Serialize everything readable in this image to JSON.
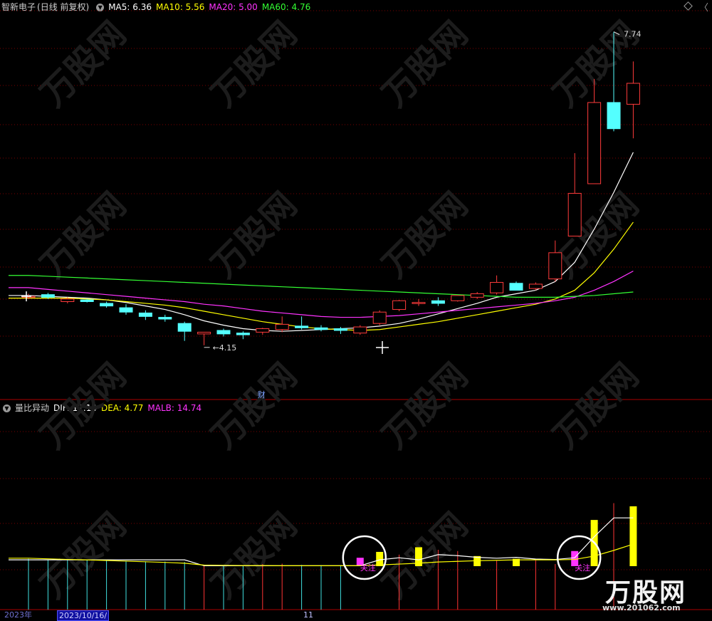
{
  "header_main": {
    "stock_name": "智新电子",
    "mode": "(日线 前复权)",
    "ma": [
      {
        "label": "MA5: 6.36",
        "color": "#ffffff"
      },
      {
        "label": "MA10: 5.56",
        "color": "#ffff00"
      },
      {
        "label": "MA20: 5.00",
        "color": "#ff33ff"
      },
      {
        "label": "MA60: 4.76",
        "color": "#33ff33"
      }
    ]
  },
  "header_sub": {
    "name": "量比异动",
    "items": [
      {
        "label": "DIF: 12.14",
        "color": "#ffffff"
      },
      {
        "label": "DEA: 4.77",
        "color": "#ffff00"
      },
      {
        "label": "MALB: 14.74",
        "color": "#ff33ff"
      }
    ]
  },
  "annotations": {
    "high_label": "7.74",
    "low_label": "4.15",
    "finance_marker": "财",
    "signal_text": "关注"
  },
  "bottom_axis": {
    "labels": [
      "2023年",
      "2023/10/16/",
      "11"
    ]
  },
  "watermark": {
    "brand": "万股网",
    "url": "www.201062.com"
  },
  "chart_data": {
    "type": "candlestick",
    "price_range": [
      3.7,
      7.9
    ],
    "high_mark": 7.74,
    "low_mark": 4.15,
    "candles": [
      {
        "o": 4.71,
        "h": 4.74,
        "l": 4.68,
        "c": 4.71
      },
      {
        "o": 4.73,
        "h": 4.75,
        "l": 4.68,
        "c": 4.7
      },
      {
        "o": 4.65,
        "h": 4.7,
        "l": 4.63,
        "c": 4.68
      },
      {
        "o": 4.67,
        "h": 4.68,
        "l": 4.64,
        "c": 4.65
      },
      {
        "o": 4.63,
        "h": 4.65,
        "l": 4.58,
        "c": 4.6
      },
      {
        "o": 4.58,
        "h": 4.62,
        "l": 4.5,
        "c": 4.53
      },
      {
        "o": 4.52,
        "h": 4.55,
        "l": 4.44,
        "c": 4.48
      },
      {
        "o": 4.47,
        "h": 4.5,
        "l": 4.42,
        "c": 4.45
      },
      {
        "o": 4.4,
        "h": 4.42,
        "l": 4.2,
        "c": 4.31
      },
      {
        "o": 4.28,
        "h": 4.3,
        "l": 4.15,
        "c": 4.3
      },
      {
        "o": 4.32,
        "h": 4.34,
        "l": 4.25,
        "c": 4.28
      },
      {
        "o": 4.29,
        "h": 4.31,
        "l": 4.22,
        "c": 4.27
      },
      {
        "o": 4.3,
        "h": 4.35,
        "l": 4.27,
        "c": 4.34
      },
      {
        "o": 4.33,
        "h": 4.48,
        "l": 4.3,
        "c": 4.39
      },
      {
        "o": 4.37,
        "h": 4.48,
        "l": 4.33,
        "c": 4.35
      },
      {
        "o": 4.35,
        "h": 4.38,
        "l": 4.31,
        "c": 4.33
      },
      {
        "o": 4.34,
        "h": 4.36,
        "l": 4.28,
        "c": 4.32
      },
      {
        "o": 4.29,
        "h": 4.38,
        "l": 4.27,
        "c": 4.36
      },
      {
        "o": 4.4,
        "h": 4.55,
        "l": 4.38,
        "c": 4.53
      },
      {
        "o": 4.56,
        "h": 4.67,
        "l": 4.54,
        "c": 4.66
      },
      {
        "o": 4.63,
        "h": 4.68,
        "l": 4.6,
        "c": 4.64
      },
      {
        "o": 4.66,
        "h": 4.7,
        "l": 4.6,
        "c": 4.63
      },
      {
        "o": 4.66,
        "h": 4.72,
        "l": 4.65,
        "c": 4.72
      },
      {
        "o": 4.7,
        "h": 4.76,
        "l": 4.68,
        "c": 4.74
      },
      {
        "o": 4.75,
        "h": 4.95,
        "l": 4.73,
        "c": 4.87
      },
      {
        "o": 4.86,
        "h": 4.88,
        "l": 4.78,
        "c": 4.78
      },
      {
        "o": 4.8,
        "h": 4.87,
        "l": 4.78,
        "c": 4.85
      },
      {
        "o": 4.91,
        "h": 5.35,
        "l": 4.88,
        "c": 5.21
      },
      {
        "o": 5.4,
        "h": 6.35,
        "l": 5.4,
        "c": 5.89
      },
      {
        "o": 6.0,
        "h": 7.2,
        "l": 6.0,
        "c": 6.93
      },
      {
        "o": 6.93,
        "h": 7.74,
        "l": 6.6,
        "c": 6.63
      },
      {
        "o": 6.91,
        "h": 7.4,
        "l": 6.52,
        "c": 7.15
      }
    ],
    "ma_lines": [
      {
        "name": "MA5",
        "color": "#ffffff",
        "values": [
          4.72,
          4.71,
          4.7,
          4.69,
          4.67,
          4.64,
          4.6,
          4.56,
          4.5,
          4.43,
          4.38,
          4.34,
          4.32,
          4.31,
          4.32,
          4.33,
          4.34,
          4.35,
          4.37,
          4.4,
          4.45,
          4.51,
          4.57,
          4.63,
          4.7,
          4.74,
          4.78,
          4.88,
          5.1,
          5.48,
          5.9,
          6.36
        ]
      },
      {
        "name": "MA10",
        "color": "#ffff00",
        "values": [
          4.69,
          4.69,
          4.69,
          4.68,
          4.67,
          4.65,
          4.63,
          4.61,
          4.58,
          4.54,
          4.5,
          4.46,
          4.42,
          4.39,
          4.36,
          4.34,
          4.33,
          4.32,
          4.33,
          4.36,
          4.39,
          4.42,
          4.46,
          4.5,
          4.54,
          4.58,
          4.62,
          4.68,
          4.78,
          4.98,
          5.25,
          5.56
        ]
      },
      {
        "name": "MA20",
        "color": "#ff33ff",
        "values": [
          4.81,
          4.79,
          4.77,
          4.75,
          4.73,
          4.71,
          4.69,
          4.67,
          4.65,
          4.62,
          4.6,
          4.57,
          4.54,
          4.52,
          4.5,
          4.48,
          4.47,
          4.47,
          4.48,
          4.49,
          4.51,
          4.53,
          4.55,
          4.57,
          4.59,
          4.61,
          4.63,
          4.66,
          4.7,
          4.78,
          4.88,
          5.0
        ]
      },
      {
        "name": "MA60",
        "color": "#33ff33",
        "values": [
          4.95,
          4.94,
          4.93,
          4.92,
          4.91,
          4.9,
          4.89,
          4.88,
          4.87,
          4.86,
          4.85,
          4.84,
          4.83,
          4.82,
          4.81,
          4.8,
          4.79,
          4.78,
          4.77,
          4.76,
          4.75,
          4.74,
          4.73,
          4.72,
          4.71,
          4.7,
          4.7,
          4.7,
          4.71,
          4.72,
          4.74,
          4.76
        ]
      }
    ],
    "indicator": {
      "range": [
        0,
        7.9
      ],
      "bars": [
        {
          "v": 0.35,
          "color": "#40e0e0",
          "kind": "line"
        },
        {
          "v": 0.32,
          "color": "#40e0e0",
          "kind": "line"
        },
        {
          "v": 0.3,
          "color": "#40e0e0",
          "kind": "line"
        },
        {
          "v": 0.3,
          "color": "#40e0e0",
          "kind": "line"
        },
        {
          "v": 0.28,
          "color": "#40e0e0",
          "kind": "line"
        },
        {
          "v": 0.25,
          "color": "#40e0e0",
          "kind": "line"
        },
        {
          "v": 0.23,
          "color": "#40e0e0",
          "kind": "line"
        },
        {
          "v": 0.22,
          "color": "#40e0e0",
          "kind": "line"
        },
        {
          "v": 0.2,
          "color": "#40e0e0",
          "kind": "line"
        },
        {
          "v": 0.06,
          "color": "#ff3333",
          "kind": "line"
        },
        {
          "v": 0.05,
          "color": "#40e0e0",
          "kind": "line"
        },
        {
          "v": 0.05,
          "color": "#40e0e0",
          "kind": "line"
        },
        {
          "v": 0.1,
          "color": "#ff3333",
          "kind": "line"
        },
        {
          "v": 0.12,
          "color": "#ff3333",
          "kind": "line"
        },
        {
          "v": 0.06,
          "color": "#40e0e0",
          "kind": "line"
        },
        {
          "v": 0.05,
          "color": "#40e0e0",
          "kind": "line"
        },
        {
          "v": 0.05,
          "color": "#40e0e0",
          "kind": "line"
        },
        {
          "v": 0.4,
          "color": "#ff33ff",
          "kind": "bar"
        },
        {
          "v": 0.68,
          "color": "#ffff00",
          "kind": "bar"
        },
        {
          "v": 0.55,
          "color": "#ff3333",
          "kind": "line"
        },
        {
          "v": 0.9,
          "color": "#ffff00",
          "kind": "bar"
        },
        {
          "v": 0.78,
          "color": "#ff3333",
          "kind": "line"
        },
        {
          "v": 0.72,
          "color": "#ff3333",
          "kind": "line"
        },
        {
          "v": 0.48,
          "color": "#ffff00",
          "kind": "bar"
        },
        {
          "v": 0.26,
          "color": "#ff3333",
          "kind": "line"
        },
        {
          "v": 0.35,
          "color": "#ffff00",
          "kind": "bar"
        },
        {
          "v": 0.28,
          "color": "#ff3333",
          "kind": "line"
        },
        {
          "v": 0.1,
          "color": "#ff3333",
          "kind": "line"
        },
        {
          "v": 0.72,
          "color": "#ff33ff",
          "kind": "bar"
        },
        {
          "v": 2.2,
          "color": "#ffff00",
          "kind": "bar"
        },
        {
          "v": 3.0,
          "color": "#ff3333",
          "kind": "line"
        },
        {
          "v": 2.85,
          "color": "#ffff00",
          "kind": "bar"
        }
      ],
      "lines": [
        {
          "name": "DIF",
          "color": "#ffffff",
          "values": [
            0.3,
            0.3,
            0.3,
            0.3,
            0.3,
            0.3,
            0.3,
            0.3,
            0.3,
            0.02,
            0.02,
            0.02,
            0.02,
            0.02,
            0.02,
            0.02,
            0.02,
            0.02,
            0.3,
            0.4,
            0.3,
            0.55,
            0.5,
            0.42,
            0.38,
            0.42,
            0.34,
            0.32,
            0.4,
            1.4,
            2.3,
            2.3
          ]
        },
        {
          "name": "DEA",
          "color": "#ffff00",
          "values": [
            0.38,
            0.35,
            0.32,
            0.3,
            0.27,
            0.24,
            0.21,
            0.18,
            0.14,
            0.05,
            0.04,
            0.03,
            0.03,
            0.02,
            0.02,
            0.02,
            0.02,
            0.02,
            0.06,
            0.1,
            0.14,
            0.2,
            0.23,
            0.26,
            0.28,
            0.3,
            0.3,
            0.3,
            0.32,
            0.48,
            0.75,
            1.05
          ]
        }
      ],
      "signals": [
        17,
        28
      ]
    }
  }
}
